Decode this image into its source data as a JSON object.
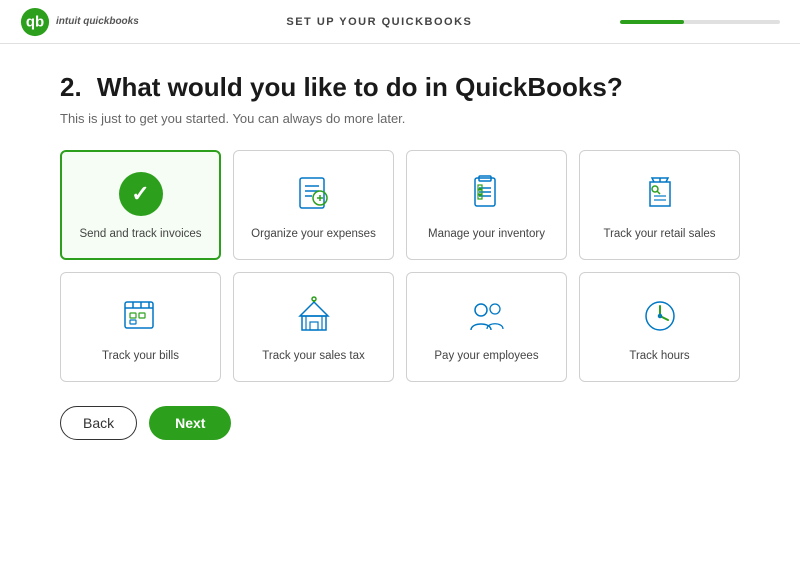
{
  "header": {
    "title": "SET UP YOUR QUICKBOOKS",
    "progress_pct": 40
  },
  "page": {
    "step": "2.",
    "heading": "What would you like to do in QuickBooks?",
    "subheading": "This is just to get you started. You can always do more later."
  },
  "options": [
    {
      "id": "invoices",
      "label": "Send and track invoices",
      "selected": true,
      "icon": "invoice"
    },
    {
      "id": "expenses",
      "label": "Organize your expenses",
      "selected": false,
      "icon": "expenses"
    },
    {
      "id": "inventory",
      "label": "Manage your inventory",
      "selected": false,
      "icon": "inventory"
    },
    {
      "id": "retail",
      "label": "Track your retail sales",
      "selected": false,
      "icon": "retail"
    },
    {
      "id": "bills",
      "label": "Track your bills",
      "selected": false,
      "icon": "bills"
    },
    {
      "id": "salestax",
      "label": "Track your sales tax",
      "selected": false,
      "icon": "salestax"
    },
    {
      "id": "employees",
      "label": "Pay your employees",
      "selected": false,
      "icon": "employees"
    },
    {
      "id": "hours",
      "label": "Track hours",
      "selected": false,
      "icon": "hours"
    }
  ],
  "buttons": {
    "back": "Back",
    "next": "Next"
  }
}
